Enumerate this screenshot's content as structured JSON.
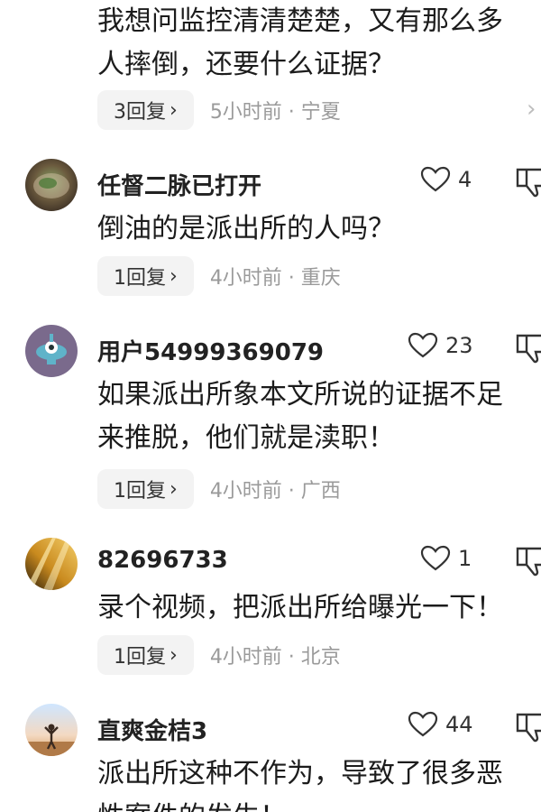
{
  "top_comment": {
    "lines": [
      "我想问监控清清楚楚，又有那么多",
      "人摔倒，还要什么证据？"
    ],
    "reply_label": "3回复",
    "meta": "5小时前 · 宁夏"
  },
  "comments": [
    {
      "username": "任督二脉已打开",
      "likes": "4",
      "lines": [
        "倒油的是派出所的人吗？"
      ],
      "reply_label": "1回复",
      "meta": "4小时前 · 重庆"
    },
    {
      "username": "用户54999369079",
      "likes": "23",
      "lines": [
        "如果派出所象本文所说的证据不足",
        "来推脱，他们就是渎职！"
      ],
      "reply_label": "1回复",
      "meta": "4小时前 · 广西"
    },
    {
      "username": "82696733",
      "likes": "1",
      "lines": [
        "录个视频，把派出所给曝光一下！"
      ],
      "reply_label": "1回复",
      "meta": "4小时前 · 北京"
    },
    {
      "username": "直爽金桔3",
      "likes": "44",
      "lines": [
        "派出所这种不作为，导致了很多恶",
        "性案件的发生！"
      ],
      "reply_label": "",
      "meta": ""
    }
  ],
  "icons": {
    "like": "heart-outline-icon",
    "dislike": "thumbs-down-icon",
    "chevron": "chevron-right-icon"
  }
}
